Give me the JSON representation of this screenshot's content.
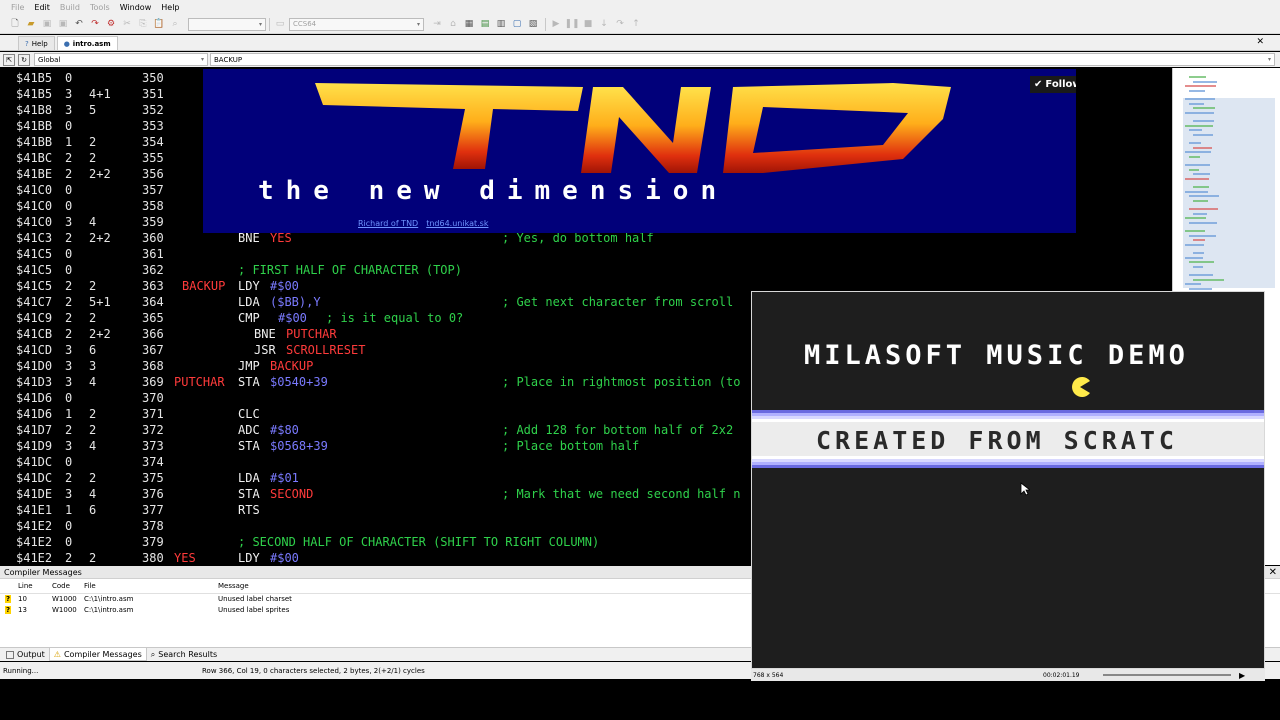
{
  "menu": {
    "items": [
      {
        "label": "File",
        "disabled": true
      },
      {
        "label": "Edit",
        "disabled": false
      },
      {
        "label": "Build",
        "disabled": true
      },
      {
        "label": "Tools",
        "disabled": true
      },
      {
        "label": "Window",
        "disabled": false
      },
      {
        "label": "Help",
        "disabled": false
      }
    ]
  },
  "toolbar": {
    "target_combo": "CCS64"
  },
  "tabs": [
    {
      "label": "Help",
      "active": false
    },
    {
      "label": "intro.asm",
      "active": true
    }
  ],
  "scope": {
    "scope_value": "Global",
    "symbol_value": "BACKUP"
  },
  "banner": {
    "follow_label": "Follow",
    "link1": "Richard of TND",
    "link2": "tnd64.unikat.sk",
    "logo_text": "TND",
    "tagline": "the new dimension"
  },
  "code": {
    "lines": [
      {
        "addr": "$41B5",
        "c1": "0",
        "c2": "",
        "ln": "350",
        "label": "",
        "mn": "",
        "op": "",
        "cm": ""
      },
      {
        "addr": "$41B5",
        "c1": "3",
        "c2": "4+1",
        "ln": "351",
        "label": "",
        "mn": "",
        "op": "",
        "cm": ""
      },
      {
        "addr": "$41B8",
        "c1": "3",
        "c2": "5",
        "ln": "352",
        "label": "",
        "mn": "",
        "op": "",
        "cm": ""
      },
      {
        "addr": "$41BB",
        "c1": "0",
        "c2": "",
        "ln": "353",
        "label": "",
        "mn": "",
        "op": "",
        "cm": ""
      },
      {
        "addr": "$41BB",
        "c1": "1",
        "c2": "2",
        "ln": "354",
        "label": "",
        "mn": "",
        "op": "",
        "cm": ""
      },
      {
        "addr": "$41BC",
        "c1": "2",
        "c2": "2",
        "ln": "355",
        "label": "",
        "mn": "",
        "op": "",
        "cm": ""
      },
      {
        "addr": "$41BE",
        "c1": "2",
        "c2": "2+2",
        "ln": "356",
        "label": "",
        "mn": "",
        "op": "",
        "cm": ""
      },
      {
        "addr": "$41C0",
        "c1": "0",
        "c2": "",
        "ln": "357",
        "label": "",
        "mn": "",
        "op": "",
        "cm": ""
      },
      {
        "addr": "$41C0",
        "c1": "0",
        "c2": "",
        "ln": "358",
        "label": "",
        "mn": "",
        "op": "",
        "cm": ""
      },
      {
        "addr": "$41C0",
        "c1": "3",
        "c2": "4",
        "ln": "359",
        "label": "",
        "mn": "",
        "op": "",
        "cm": ""
      },
      {
        "addr": "$41C3",
        "c1": "2",
        "c2": "2+2",
        "ln": "360",
        "label": "",
        "mn": "BNE",
        "op": "YES",
        "cm": "; Yes, do bottom half"
      },
      {
        "addr": "$41C5",
        "c1": "0",
        "c2": "",
        "ln": "361",
        "label": "",
        "mn": "",
        "op": "",
        "cm": ""
      },
      {
        "addr": "$41C5",
        "c1": "0",
        "c2": "",
        "ln": "362",
        "label": "",
        "mn": "",
        "op": "",
        "cm": "; FIRST HALF OF CHARACTER (TOP)"
      },
      {
        "addr": "$41C5",
        "c1": "2",
        "c2": "2",
        "ln": "363",
        "label": "BACKUP",
        "mn": "LDY",
        "op": "#$00",
        "cm": ""
      },
      {
        "addr": "$41C7",
        "c1": "2",
        "c2": "5+1",
        "ln": "364",
        "label": "",
        "mn": "LDA",
        "op": "($BB),Y",
        "cm": "; Get next character from scroll"
      },
      {
        "addr": "$41C9",
        "c1": "2",
        "c2": "2",
        "ln": "365",
        "label": "",
        "mn": "CMP",
        "op": "#$00",
        "cm": "; is it equal to 0?"
      },
      {
        "addr": "$41CB",
        "c1": "2",
        "c2": "2+2",
        "ln": "366",
        "label": "",
        "mn": "BNE",
        "op": "PUTCHAR",
        "cm": ""
      },
      {
        "addr": "$41CD",
        "c1": "3",
        "c2": "6",
        "ln": "367",
        "label": "",
        "mn": "JSR",
        "op": "SCROLLRESET",
        "cm": ""
      },
      {
        "addr": "$41D0",
        "c1": "3",
        "c2": "3",
        "ln": "368",
        "label": "",
        "mn": "JMP",
        "op": "BACKUP",
        "cm": ""
      },
      {
        "addr": "$41D3",
        "c1": "3",
        "c2": "4",
        "ln": "369",
        "label": "PUTCHAR",
        "mn": "STA",
        "op": "$0540+39",
        "cm": "; Place in rightmost position (to"
      },
      {
        "addr": "$41D6",
        "c1": "0",
        "c2": "",
        "ln": "370",
        "label": "",
        "mn": "",
        "op": "",
        "cm": ""
      },
      {
        "addr": "$41D6",
        "c1": "1",
        "c2": "2",
        "ln": "371",
        "label": "",
        "mn": "CLC",
        "op": "",
        "cm": ""
      },
      {
        "addr": "$41D7",
        "c1": "2",
        "c2": "2",
        "ln": "372",
        "label": "",
        "mn": "ADC",
        "op": "#$80",
        "cm": "; Add 128 for bottom half of 2x2"
      },
      {
        "addr": "$41D9",
        "c1": "3",
        "c2": "4",
        "ln": "373",
        "label": "",
        "mn": "STA",
        "op": "$0568+39",
        "cm": "; Place bottom half"
      },
      {
        "addr": "$41DC",
        "c1": "0",
        "c2": "",
        "ln": "374",
        "label": "",
        "mn": "",
        "op": "",
        "cm": ""
      },
      {
        "addr": "$41DC",
        "c1": "2",
        "c2": "2",
        "ln": "375",
        "label": "",
        "mn": "LDA",
        "op": "#$01",
        "cm": ""
      },
      {
        "addr": "$41DE",
        "c1": "3",
        "c2": "4",
        "ln": "376",
        "label": "",
        "mn": "STA",
        "op": "SECOND",
        "cm": "; Mark that we need second half n"
      },
      {
        "addr": "$41E1",
        "c1": "1",
        "c2": "6",
        "ln": "377",
        "label": "",
        "mn": "RTS",
        "op": "",
        "cm": ""
      },
      {
        "addr": "$41E2",
        "c1": "0",
        "c2": "",
        "ln": "378",
        "label": "",
        "mn": "",
        "op": "",
        "cm": ""
      },
      {
        "addr": "$41E2",
        "c1": "0",
        "c2": "",
        "ln": "379",
        "label": "",
        "mn": "",
        "op": "",
        "cm": "; SECOND HALF OF CHARACTER (SHIFT TO RIGHT COLUMN)"
      },
      {
        "addr": "$41E2",
        "c1": "2",
        "c2": "2",
        "ln": "380",
        "label": "YES",
        "mn": "LDY",
        "op": "#$00",
        "cm": ""
      }
    ]
  },
  "messages": {
    "title": "Compiler Messages",
    "columns": {
      "line": "Line",
      "code": "Code",
      "file": "File",
      "message": "Message"
    },
    "rows": [
      {
        "line": "10",
        "code": "W1000",
        "file": "C:\\1\\intro.asm",
        "message": "Unused label charset"
      },
      {
        "line": "13",
        "code": "W1000",
        "file": "C:\\1\\intro.asm",
        "message": "Unused label sprites"
      }
    ]
  },
  "bottom_tabs": [
    {
      "label": "Output",
      "active": false
    },
    {
      "label": "Compiler Messages",
      "active": true
    },
    {
      "label": "Search Results",
      "active": false
    }
  ],
  "status": {
    "left": "Running...",
    "position": "Row 366, Col 19, 0 characters selected, 2 bytes, 2(+2/1) cycles"
  },
  "emulator": {
    "title_text": "MILASOFT MUSIC DEMO",
    "scroll_text": "CREATED FROM SCRATC",
    "resolution": "768 x 564",
    "time": "00:02:01.19"
  },
  "colors": {
    "editor_bg": "#000000",
    "comment": "#2fd14b",
    "label": "#ff3b3b",
    "operand": "#7a7aff",
    "banner_bg": "#01007a"
  }
}
